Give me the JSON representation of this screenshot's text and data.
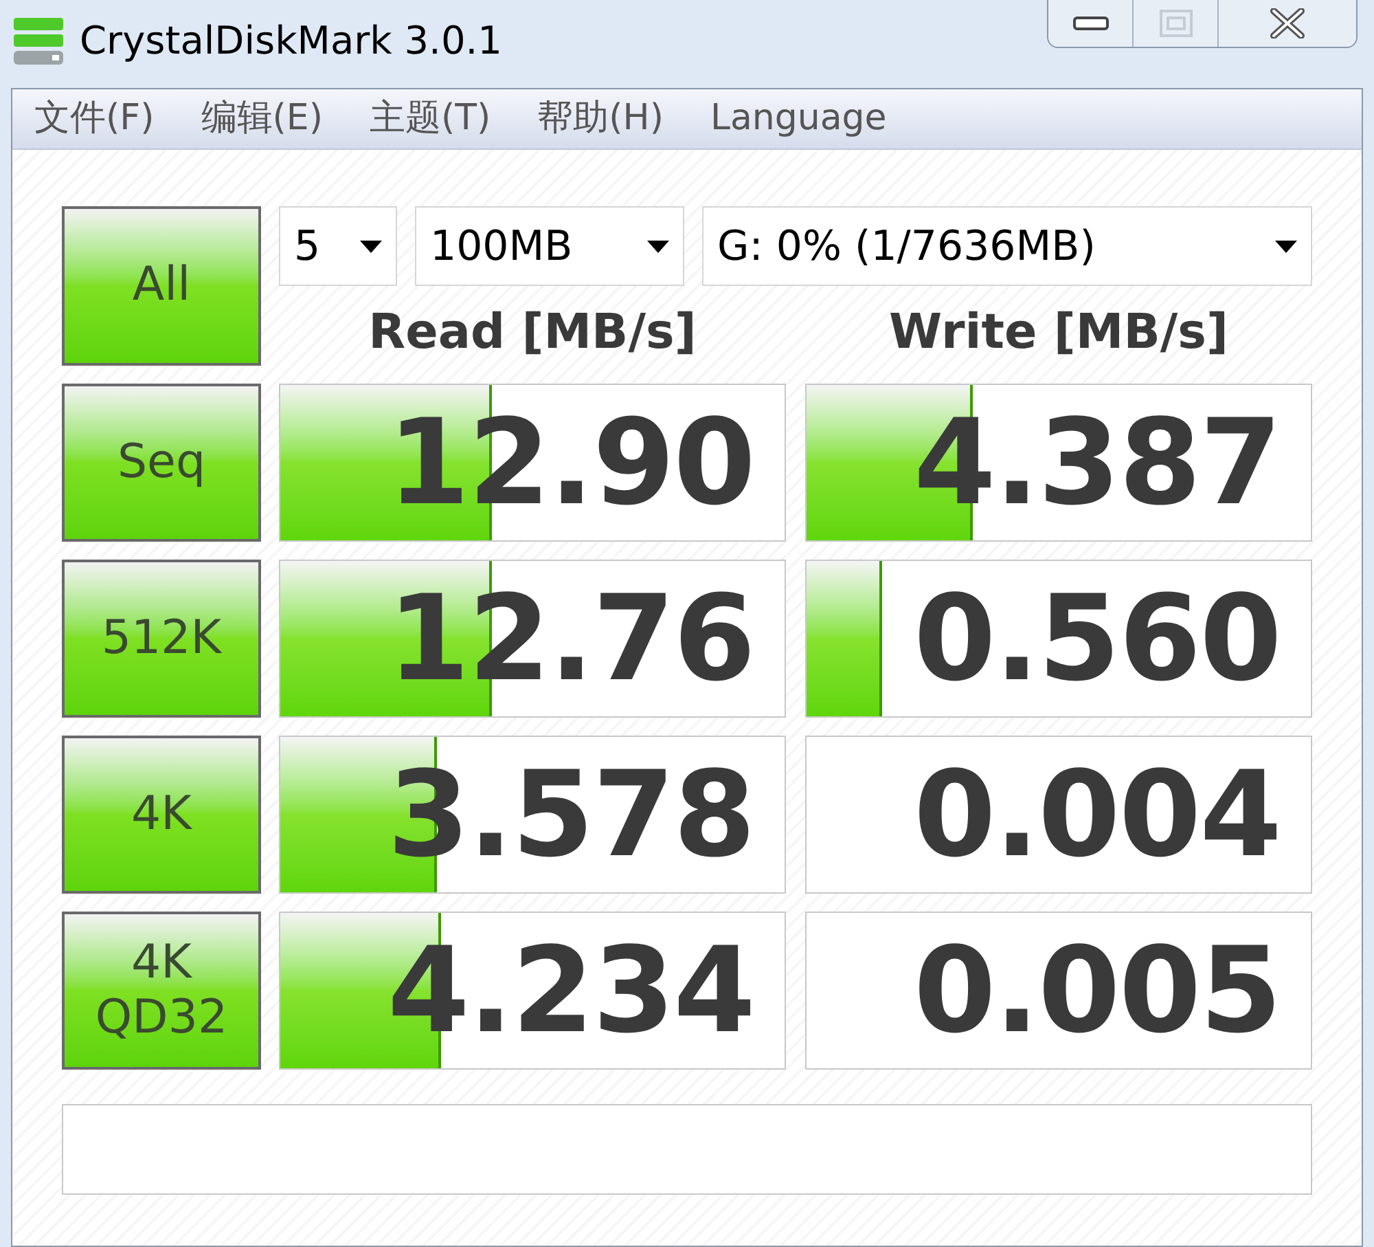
{
  "window": {
    "title": "CrystalDiskMark 3.0.1",
    "maximize_disabled": true
  },
  "menu": [
    "文件(F)",
    "编辑(E)",
    "主题(T)",
    "帮助(H)",
    "Language"
  ],
  "all_button": "All",
  "selects": [
    {
      "value": "5"
    },
    {
      "value": "100MB"
    },
    {
      "value": "G: 0% (1/7636MB)"
    }
  ],
  "columns": [
    "Read [MB/s]",
    "Write [MB/s]"
  ],
  "rows": [
    {
      "label": "Seq",
      "read": {
        "value": "12.90",
        "level": 0.42
      },
      "write": {
        "value": "4.387",
        "level": 0.33
      }
    },
    {
      "label": "512K",
      "read": {
        "value": "12.76",
        "level": 0.42
      },
      "write": {
        "value": "0.560",
        "level": 0.15
      }
    },
    {
      "label": "4K",
      "read": {
        "value": "3.578",
        "level": 0.31
      },
      "write": {
        "value": "0.004"
      }
    },
    {
      "label": "4K\nQD32",
      "read": {
        "value": "4.234",
        "level": 0.32
      },
      "write": {
        "value": "0.005"
      }
    }
  ]
}
